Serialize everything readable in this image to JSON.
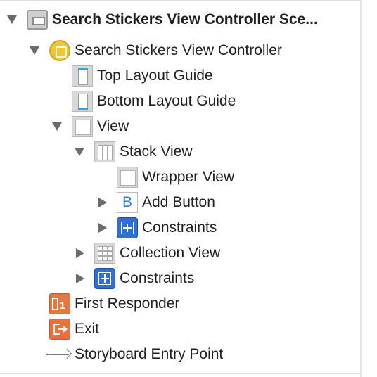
{
  "outline": {
    "items": [
      {
        "label": "Search Stickers View Controller Sce...",
        "icon": "storyboard-scene-icon",
        "disclosure": "expanded",
        "bold": true
      },
      {
        "label": "Search Stickers View Controller",
        "icon": "view-controller-icon",
        "disclosure": "expanded"
      },
      {
        "label": "Top Layout Guide",
        "icon": "top-layout-guide-icon",
        "disclosure": "none"
      },
      {
        "label": "Bottom Layout Guide",
        "icon": "bottom-layout-guide-icon",
        "disclosure": "none"
      },
      {
        "label": "View",
        "icon": "view-icon",
        "disclosure": "expanded"
      },
      {
        "label": "Stack View",
        "icon": "stack-view-icon",
        "disclosure": "expanded"
      },
      {
        "label": "Wrapper View",
        "icon": "view-icon",
        "disclosure": "none"
      },
      {
        "label": "Add Button",
        "icon": "button-icon",
        "disclosure": "collapsed",
        "icon_glyph": "B"
      },
      {
        "label": "Constraints",
        "icon": "constraints-icon",
        "disclosure": "collapsed"
      },
      {
        "label": "Collection View",
        "icon": "collection-view-icon",
        "disclosure": "collapsed"
      },
      {
        "label": "Constraints",
        "icon": "constraints-icon",
        "disclosure": "collapsed"
      },
      {
        "label": "First Responder",
        "icon": "first-responder-icon",
        "disclosure": "none",
        "icon_glyph": "1"
      },
      {
        "label": "Exit",
        "icon": "exit-icon",
        "disclosure": "none"
      },
      {
        "label": "Storyboard Entry Point",
        "icon": "entry-point-arrow-icon",
        "disclosure": "none"
      }
    ]
  },
  "colors": {
    "view_controller": "#f4c431",
    "constraints": "#2e6fcf",
    "first_responder": "#e8773a",
    "exit": "#ef6f3a",
    "button_glyph": "#2d7fd6",
    "guide_bar": "#3aa0e0"
  }
}
